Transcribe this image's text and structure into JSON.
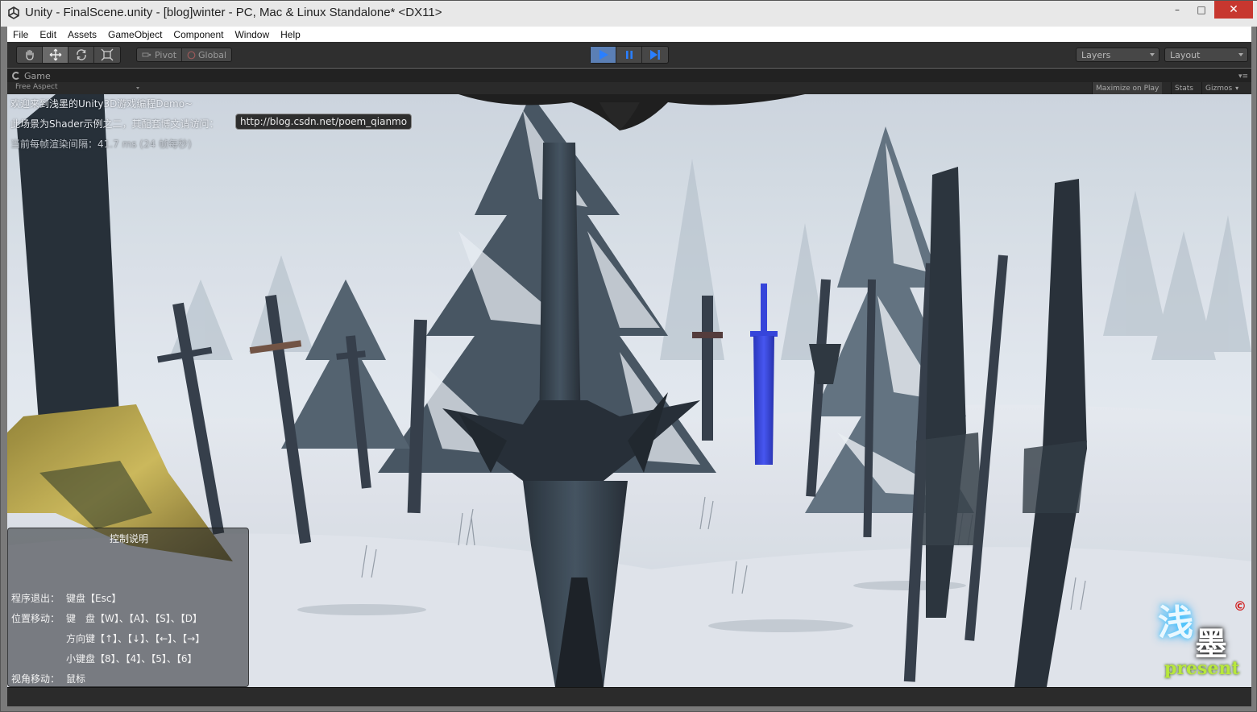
{
  "window": {
    "title": "Unity - FinalScene.unity - [blog]winter - PC, Mac & Linux Standalone* <DX11>",
    "minimize": "–",
    "maximize": "□",
    "close": "✕"
  },
  "menu": [
    "File",
    "Edit",
    "Assets",
    "GameObject",
    "Component",
    "Window",
    "Help"
  ],
  "toolbar": {
    "transform_tools": [
      "hand-icon",
      "move-icon",
      "rotate-icon",
      "scale-icon"
    ],
    "pivot_label": "Pivot",
    "global_label": "Global",
    "play_controls": [
      "play-icon",
      "pause-icon",
      "step-icon"
    ],
    "layers_label": "Layers",
    "layout_label": "Layout"
  },
  "game_view": {
    "tab_label": "Game",
    "aspect_label": "Free Aspect",
    "maximize_on_play": "Maximize on Play",
    "stats": "Stats",
    "gizmos": "Gizmos"
  },
  "hud": {
    "welcome": "欢迎来到浅墨的Unity3D游戏编程Demo~",
    "shader_note": "此场景为Shader示例之二，其配套博文请访问：",
    "link": "http://blog.csdn.net/poem_qianmo",
    "frame_time": "当前每帧渲染间隔：41.7 ms (24 帧每秒)"
  },
  "controls": {
    "title": "控制说明",
    "exit_label": "程序退出：",
    "exit_keys": "键盘【Esc】",
    "move_label": "位置移动：",
    "move_keys_1": "键　盘【W】、【A】、【S】、【D】",
    "move_keys_2": "方向键【↑】、【↓】、【←】、【→】",
    "move_keys_3": "小键盘【8】、【4】、【5】、【6】",
    "view_label": "视角移动：",
    "view_keys": "鼠标"
  },
  "logo": {
    "text_top": "浅",
    "text_bottom": "墨",
    "present": "present",
    "copyright": "©"
  },
  "colors": {
    "accent_play": "#5b7fb5",
    "blue_sword": "#2a3ad8",
    "logo_green": "#b8e83c",
    "logo_cyan": "#6fd8ff",
    "close_red": "#c7372f"
  }
}
